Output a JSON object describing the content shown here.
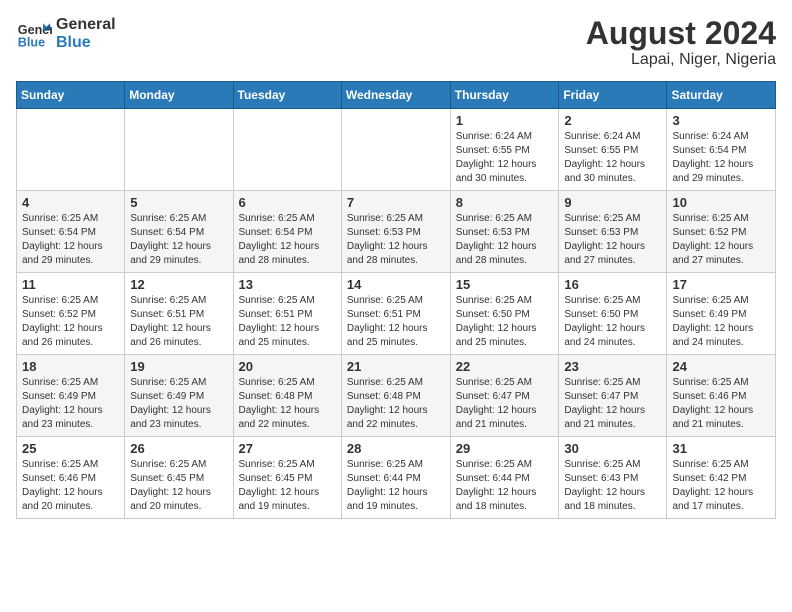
{
  "header": {
    "logo_line1": "General",
    "logo_line2": "Blue",
    "title": "August 2024",
    "subtitle": "Lapai, Niger, Nigeria"
  },
  "weekdays": [
    "Sunday",
    "Monday",
    "Tuesday",
    "Wednesday",
    "Thursday",
    "Friday",
    "Saturday"
  ],
  "weeks": [
    [
      {
        "day": "",
        "info": ""
      },
      {
        "day": "",
        "info": ""
      },
      {
        "day": "",
        "info": ""
      },
      {
        "day": "",
        "info": ""
      },
      {
        "day": "1",
        "info": "Sunrise: 6:24 AM\nSunset: 6:55 PM\nDaylight: 12 hours\nand 30 minutes."
      },
      {
        "day": "2",
        "info": "Sunrise: 6:24 AM\nSunset: 6:55 PM\nDaylight: 12 hours\nand 30 minutes."
      },
      {
        "day": "3",
        "info": "Sunrise: 6:24 AM\nSunset: 6:54 PM\nDaylight: 12 hours\nand 29 minutes."
      }
    ],
    [
      {
        "day": "4",
        "info": "Sunrise: 6:25 AM\nSunset: 6:54 PM\nDaylight: 12 hours\nand 29 minutes."
      },
      {
        "day": "5",
        "info": "Sunrise: 6:25 AM\nSunset: 6:54 PM\nDaylight: 12 hours\nand 29 minutes."
      },
      {
        "day": "6",
        "info": "Sunrise: 6:25 AM\nSunset: 6:54 PM\nDaylight: 12 hours\nand 28 minutes."
      },
      {
        "day": "7",
        "info": "Sunrise: 6:25 AM\nSunset: 6:53 PM\nDaylight: 12 hours\nand 28 minutes."
      },
      {
        "day": "8",
        "info": "Sunrise: 6:25 AM\nSunset: 6:53 PM\nDaylight: 12 hours\nand 28 minutes."
      },
      {
        "day": "9",
        "info": "Sunrise: 6:25 AM\nSunset: 6:53 PM\nDaylight: 12 hours\nand 27 minutes."
      },
      {
        "day": "10",
        "info": "Sunrise: 6:25 AM\nSunset: 6:52 PM\nDaylight: 12 hours\nand 27 minutes."
      }
    ],
    [
      {
        "day": "11",
        "info": "Sunrise: 6:25 AM\nSunset: 6:52 PM\nDaylight: 12 hours\nand 26 minutes."
      },
      {
        "day": "12",
        "info": "Sunrise: 6:25 AM\nSunset: 6:51 PM\nDaylight: 12 hours\nand 26 minutes."
      },
      {
        "day": "13",
        "info": "Sunrise: 6:25 AM\nSunset: 6:51 PM\nDaylight: 12 hours\nand 25 minutes."
      },
      {
        "day": "14",
        "info": "Sunrise: 6:25 AM\nSunset: 6:51 PM\nDaylight: 12 hours\nand 25 minutes."
      },
      {
        "day": "15",
        "info": "Sunrise: 6:25 AM\nSunset: 6:50 PM\nDaylight: 12 hours\nand 25 minutes."
      },
      {
        "day": "16",
        "info": "Sunrise: 6:25 AM\nSunset: 6:50 PM\nDaylight: 12 hours\nand 24 minutes."
      },
      {
        "day": "17",
        "info": "Sunrise: 6:25 AM\nSunset: 6:49 PM\nDaylight: 12 hours\nand 24 minutes."
      }
    ],
    [
      {
        "day": "18",
        "info": "Sunrise: 6:25 AM\nSunset: 6:49 PM\nDaylight: 12 hours\nand 23 minutes."
      },
      {
        "day": "19",
        "info": "Sunrise: 6:25 AM\nSunset: 6:49 PM\nDaylight: 12 hours\nand 23 minutes."
      },
      {
        "day": "20",
        "info": "Sunrise: 6:25 AM\nSunset: 6:48 PM\nDaylight: 12 hours\nand 22 minutes."
      },
      {
        "day": "21",
        "info": "Sunrise: 6:25 AM\nSunset: 6:48 PM\nDaylight: 12 hours\nand 22 minutes."
      },
      {
        "day": "22",
        "info": "Sunrise: 6:25 AM\nSunset: 6:47 PM\nDaylight: 12 hours\nand 21 minutes."
      },
      {
        "day": "23",
        "info": "Sunrise: 6:25 AM\nSunset: 6:47 PM\nDaylight: 12 hours\nand 21 minutes."
      },
      {
        "day": "24",
        "info": "Sunrise: 6:25 AM\nSunset: 6:46 PM\nDaylight: 12 hours\nand 21 minutes."
      }
    ],
    [
      {
        "day": "25",
        "info": "Sunrise: 6:25 AM\nSunset: 6:46 PM\nDaylight: 12 hours\nand 20 minutes."
      },
      {
        "day": "26",
        "info": "Sunrise: 6:25 AM\nSunset: 6:45 PM\nDaylight: 12 hours\nand 20 minutes."
      },
      {
        "day": "27",
        "info": "Sunrise: 6:25 AM\nSunset: 6:45 PM\nDaylight: 12 hours\nand 19 minutes."
      },
      {
        "day": "28",
        "info": "Sunrise: 6:25 AM\nSunset: 6:44 PM\nDaylight: 12 hours\nand 19 minutes."
      },
      {
        "day": "29",
        "info": "Sunrise: 6:25 AM\nSunset: 6:44 PM\nDaylight: 12 hours\nand 18 minutes."
      },
      {
        "day": "30",
        "info": "Sunrise: 6:25 AM\nSunset: 6:43 PM\nDaylight: 12 hours\nand 18 minutes."
      },
      {
        "day": "31",
        "info": "Sunrise: 6:25 AM\nSunset: 6:42 PM\nDaylight: 12 hours\nand 17 minutes."
      }
    ]
  ]
}
